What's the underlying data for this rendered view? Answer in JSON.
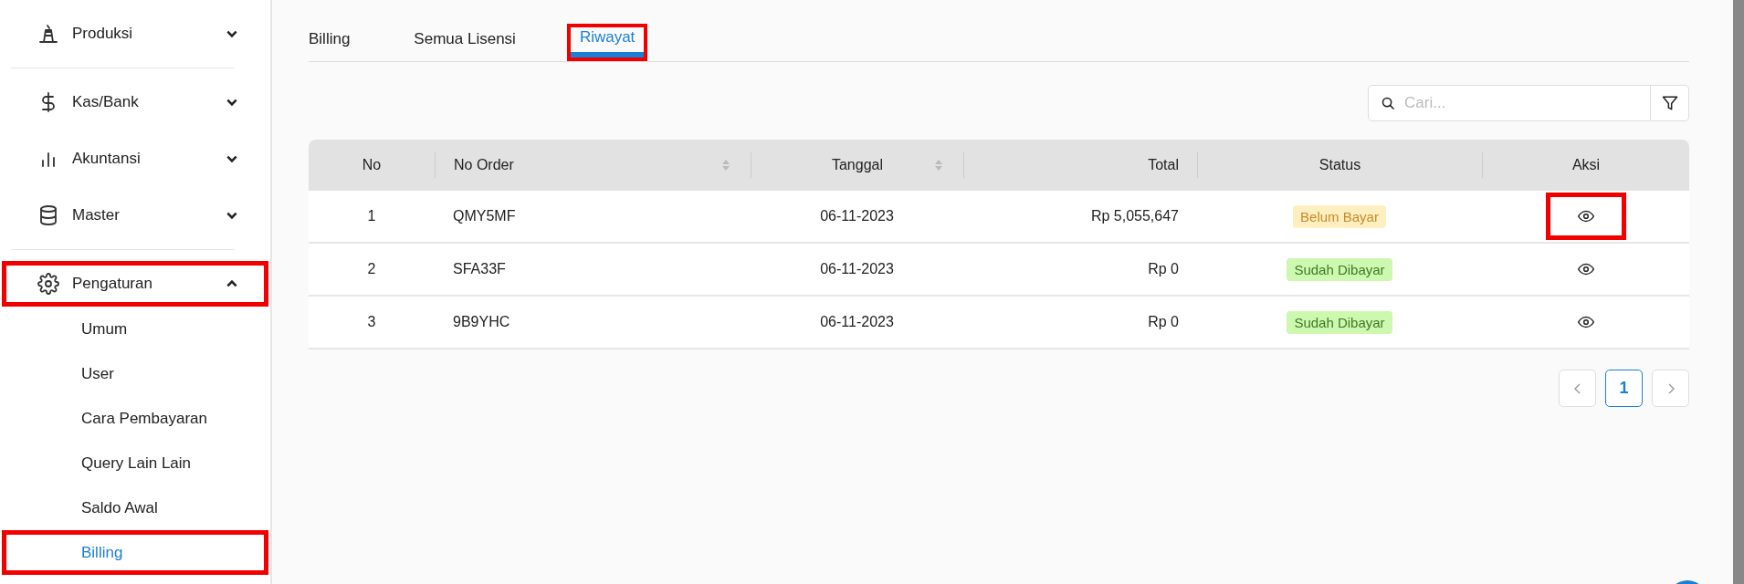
{
  "sidebar": {
    "items": [
      {
        "label": "Produksi",
        "expanded": false,
        "highlighted": false
      },
      {
        "label": "Kas/Bank",
        "expanded": false,
        "highlighted": false
      },
      {
        "label": "Akuntansi",
        "expanded": false,
        "highlighted": false
      },
      {
        "label": "Master",
        "expanded": false,
        "highlighted": false
      },
      {
        "label": "Pengaturan",
        "expanded": true,
        "highlighted": true,
        "children": [
          {
            "label": "Umum",
            "selected": false,
            "highlighted": false
          },
          {
            "label": "User",
            "selected": false,
            "highlighted": false
          },
          {
            "label": "Cara Pembayaran",
            "selected": false,
            "highlighted": false
          },
          {
            "label": "Query Lain Lain",
            "selected": false,
            "highlighted": false
          },
          {
            "label": "Saldo Awal",
            "selected": false,
            "highlighted": false
          },
          {
            "label": "Billing",
            "selected": true,
            "highlighted": true
          }
        ]
      }
    ]
  },
  "tabs": [
    {
      "label": "Billing",
      "selected": false,
      "highlighted": false
    },
    {
      "label": "Semua Lisensi",
      "selected": false,
      "highlighted": false
    },
    {
      "label": "Riwayat",
      "selected": true,
      "highlighted": true
    }
  ],
  "search": {
    "placeholder": "Cari..."
  },
  "table": {
    "columns": [
      "No",
      "No Order",
      "Tanggal",
      "Total",
      "Status",
      "Aksi"
    ],
    "rows": [
      {
        "no": "1",
        "order": "QMY5MF",
        "date": "06-11-2023",
        "total": "Rp 5,055,647",
        "status": {
          "label": "Belum Bayar",
          "kind": "unpaid"
        },
        "action_highlighted": true
      },
      {
        "no": "2",
        "order": "SFA33F",
        "date": "06-11-2023",
        "total": "Rp 0",
        "status": {
          "label": "Sudah Dibayar",
          "kind": "paid"
        },
        "action_highlighted": false
      },
      {
        "no": "3",
        "order": "9B9YHC",
        "date": "06-11-2023",
        "total": "Rp 0",
        "status": {
          "label": "Sudah Dibayar",
          "kind": "paid"
        },
        "action_highlighted": false
      }
    ]
  },
  "pagination": {
    "pages": [
      {
        "label": "1",
        "selected": true
      }
    ]
  }
}
